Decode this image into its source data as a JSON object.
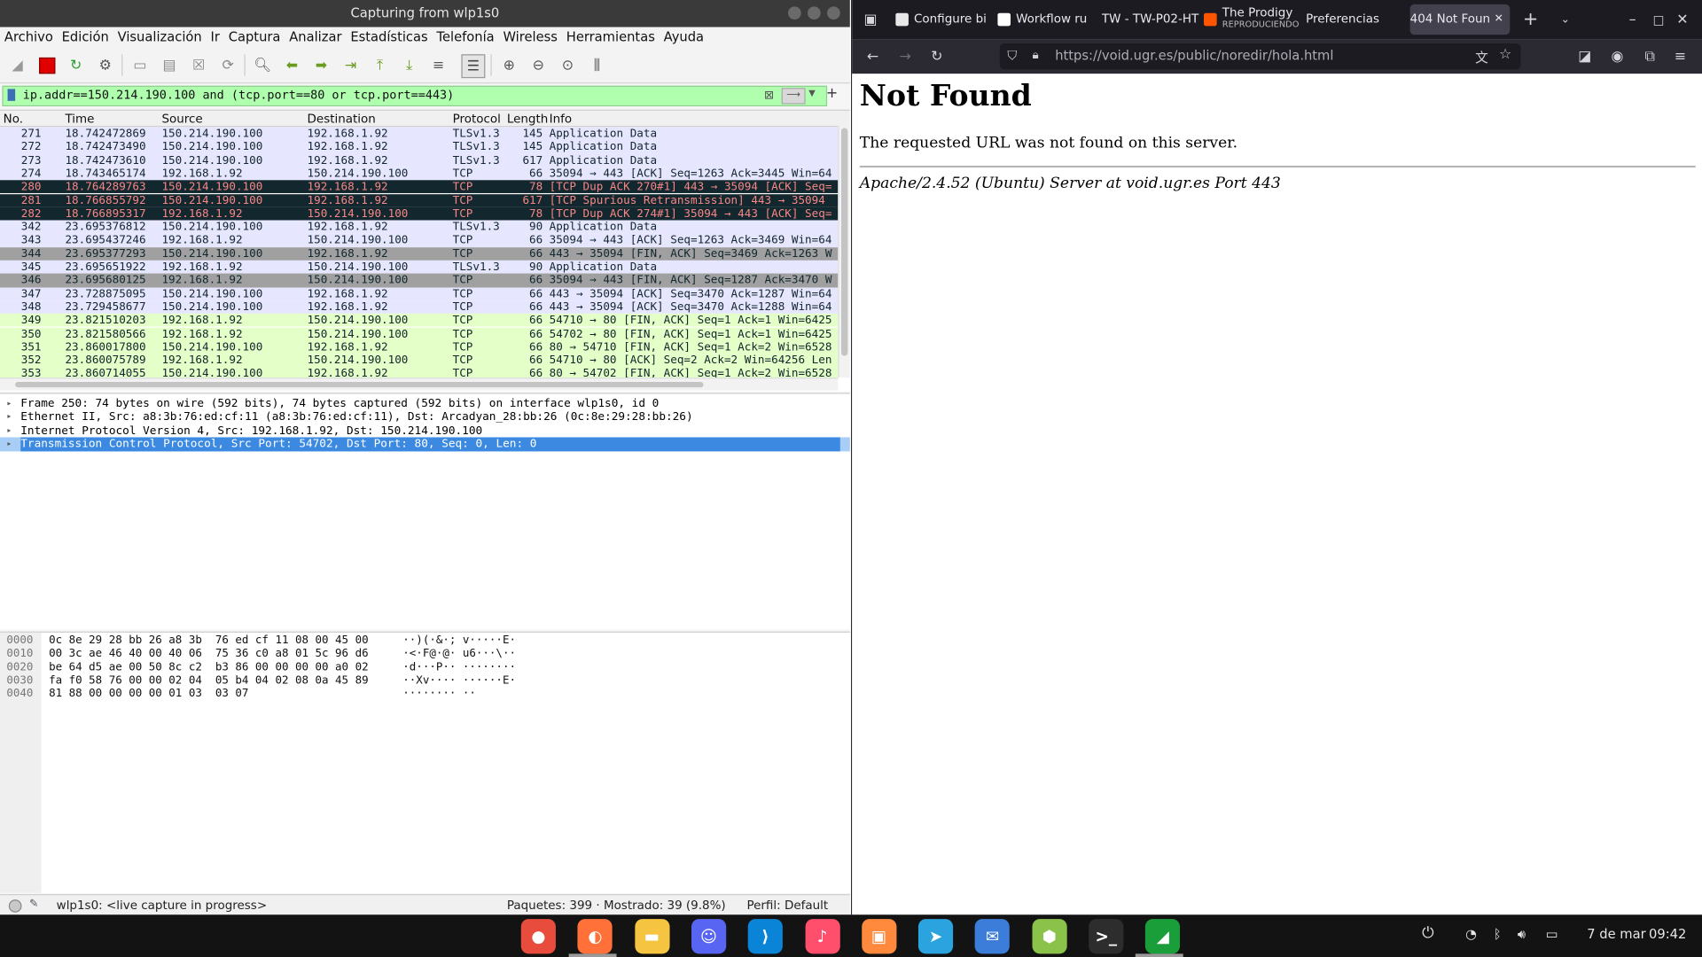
{
  "wireshark": {
    "title": "Capturing from wlp1s0",
    "menu": [
      "Archivo",
      "Edición",
      "Visualización",
      "Ir",
      "Captura",
      "Analizar",
      "Estadísticas",
      "Telefonía",
      "Wireless",
      "Herramientas",
      "Ayuda"
    ],
    "filter": "ip.addr==150.214.190.100 and (tcp.port==80 or tcp.port==443)",
    "columns": [
      "No.",
      "Time",
      "Source",
      "Destination",
      "Protocol",
      "Length",
      "Info"
    ],
    "packets": [
      {
        "no": "271",
        "time": "18.742472869",
        "src": "150.214.190.100",
        "dst": "192.168.1.92",
        "proto": "TLSv1.3",
        "len": "145",
        "info": "Application Data",
        "bg": "#e7e6ff",
        "fg": "#12272e"
      },
      {
        "no": "272",
        "time": "18.742473490",
        "src": "150.214.190.100",
        "dst": "192.168.1.92",
        "proto": "TLSv1.3",
        "len": "145",
        "info": "Application Data",
        "bg": "#e7e6ff",
        "fg": "#12272e"
      },
      {
        "no": "273",
        "time": "18.742473610",
        "src": "150.214.190.100",
        "dst": "192.168.1.92",
        "proto": "TLSv1.3",
        "len": "617",
        "info": "Application Data",
        "bg": "#e7e6ff",
        "fg": "#12272e"
      },
      {
        "no": "274",
        "time": "18.743465174",
        "src": "192.168.1.92",
        "dst": "150.214.190.100",
        "proto": "TCP",
        "len": "66",
        "info": "35094 → 443 [ACK] Seq=1263 Ack=3445 Win=64",
        "bg": "#e7e6ff",
        "fg": "#12272e"
      },
      {
        "no": "280",
        "time": "18.764289763",
        "src": "150.214.190.100",
        "dst": "192.168.1.92",
        "proto": "TCP",
        "len": "78",
        "info": "[TCP Dup ACK 270#1] 443 → 35094 [ACK] Seq=",
        "bg": "#12272e",
        "fg": "#f78787"
      },
      {
        "no": "281",
        "time": "18.766855792",
        "src": "150.214.190.100",
        "dst": "192.168.1.92",
        "proto": "TCP",
        "len": "617",
        "info": "[TCP Spurious Retransmission] 443 → 35094",
        "bg": "#12272e",
        "fg": "#f78787"
      },
      {
        "no": "282",
        "time": "18.766895317",
        "src": "192.168.1.92",
        "dst": "150.214.190.100",
        "proto": "TCP",
        "len": "78",
        "info": "[TCP Dup ACK 274#1] 35094 → 443 [ACK] Seq=",
        "bg": "#12272e",
        "fg": "#f78787"
      },
      {
        "no": "342",
        "time": "23.695376812",
        "src": "150.214.190.100",
        "dst": "192.168.1.92",
        "proto": "TLSv1.3",
        "len": "90",
        "info": "Application Data",
        "bg": "#e7e6ff",
        "fg": "#12272e"
      },
      {
        "no": "343",
        "time": "23.695437246",
        "src": "192.168.1.92",
        "dst": "150.214.190.100",
        "proto": "TCP",
        "len": "66",
        "info": "35094 → 443 [ACK] Seq=1263 Ack=3469 Win=64",
        "bg": "#e7e6ff",
        "fg": "#12272e"
      },
      {
        "no": "344",
        "time": "23.695377293",
        "src": "150.214.190.100",
        "dst": "192.168.1.92",
        "proto": "TCP",
        "len": "66",
        "info": "443 → 35094 [FIN, ACK] Seq=3469 Ack=1263 W",
        "bg": "#a0a0a0",
        "fg": "#12272e"
      },
      {
        "no": "345",
        "time": "23.695651922",
        "src": "192.168.1.92",
        "dst": "150.214.190.100",
        "proto": "TLSv1.3",
        "len": "90",
        "info": "Application Data",
        "bg": "#e7e6ff",
        "fg": "#12272e"
      },
      {
        "no": "346",
        "time": "23.695680125",
        "src": "192.168.1.92",
        "dst": "150.214.190.100",
        "proto": "TCP",
        "len": "66",
        "info": "35094 → 443 [FIN, ACK] Seq=1287 Ack=3470 W",
        "bg": "#a0a0a0",
        "fg": "#12272e"
      },
      {
        "no": "347",
        "time": "23.728875095",
        "src": "150.214.190.100",
        "dst": "192.168.1.92",
        "proto": "TCP",
        "len": "66",
        "info": "443 → 35094 [ACK] Seq=3470 Ack=1287 Win=64",
        "bg": "#e7e6ff",
        "fg": "#12272e"
      },
      {
        "no": "348",
        "time": "23.729458677",
        "src": "150.214.190.100",
        "dst": "192.168.1.92",
        "proto": "TCP",
        "len": "66",
        "info": "443 → 35094 [ACK] Seq=3470 Ack=1288 Win=64",
        "bg": "#e7e6ff",
        "fg": "#12272e"
      },
      {
        "no": "349",
        "time": "23.821510203",
        "src": "192.168.1.92",
        "dst": "150.214.190.100",
        "proto": "TCP",
        "len": "66",
        "info": "54710 → 80 [FIN, ACK] Seq=1 Ack=1 Win=6425",
        "bg": "#e4ffc7",
        "fg": "#12272e"
      },
      {
        "no": "350",
        "time": "23.821580566",
        "src": "192.168.1.92",
        "dst": "150.214.190.100",
        "proto": "TCP",
        "len": "66",
        "info": "54702 → 80 [FIN, ACK] Seq=1 Ack=1 Win=6425",
        "bg": "#e4ffc7",
        "fg": "#12272e"
      },
      {
        "no": "351",
        "time": "23.860017800",
        "src": "150.214.190.100",
        "dst": "192.168.1.92",
        "proto": "TCP",
        "len": "66",
        "info": "80 → 54710 [FIN, ACK] Seq=1 Ack=2 Win=6528",
        "bg": "#e4ffc7",
        "fg": "#12272e"
      },
      {
        "no": "352",
        "time": "23.860075789",
        "src": "192.168.1.92",
        "dst": "150.214.190.100",
        "proto": "TCP",
        "len": "66",
        "info": "54710 → 80 [ACK] Seq=2 Ack=2 Win=64256 Len",
        "bg": "#e4ffc7",
        "fg": "#12272e"
      },
      {
        "no": "353",
        "time": "23.860714055",
        "src": "150.214.190.100",
        "dst": "192.168.1.92",
        "proto": "TCP",
        "len": "66",
        "info": "80 → 54702 [FIN, ACK] Seq=1 Ack=2 Win=6528",
        "bg": "#e4ffc7",
        "fg": "#12272e"
      }
    ],
    "details": [
      {
        "text": "Frame 250: 74 bytes on wire (592 bits), 74 bytes captured (592 bits) on interface wlp1s0, id 0",
        "selected": false
      },
      {
        "text": "Ethernet II, Src: a8:3b:76:ed:cf:11 (a8:3b:76:ed:cf:11), Dst: Arcadyan_28:bb:26 (0c:8e:29:28:bb:26)",
        "selected": false
      },
      {
        "text": "Internet Protocol Version 4, Src: 192.168.1.92, Dst: 150.214.190.100",
        "selected": false
      },
      {
        "text": "Transmission Control Protocol, Src Port: 54702, Dst Port: 80, Seq: 0, Len: 0",
        "selected": true
      }
    ],
    "hex": [
      {
        "off": "0000",
        "bytes": "0c 8e 29 28 bb 26 a8 3b  76 ed cf 11 08 00 45 00",
        "ascii": "··)(·&·; v·····E·"
      },
      {
        "off": "0010",
        "bytes": "00 3c ae 46 40 00 40 06  75 36 c0 a8 01 5c 96 d6",
        "ascii": "·<·F@·@· u6···\\··"
      },
      {
        "off": "0020",
        "bytes": "be 64 d5 ae 00 50 8c c2  b3 86 00 00 00 00 a0 02",
        "ascii": "·d···P·· ········"
      },
      {
        "off": "0030",
        "bytes": "fa f0 58 76 00 00 02 04  05 b4 04 02 08 0a 45 89",
        "ascii": "··Xv···· ······E·"
      },
      {
        "off": "0040",
        "bytes": "81 88 00 00 00 00 01 03  03 07",
        "ascii": "········ ··"
      }
    ],
    "status": {
      "interface": "wlp1s0: <live capture in progress>",
      "packets": "Paquetes: 399 · Mostrado: 39 (9.8%)",
      "profile": "Perfil: Default"
    }
  },
  "firefox": {
    "tabs": [
      {
        "label": "Configure bi",
        "icon_color": "#e8e8e8",
        "active": false
      },
      {
        "label": "Workflow ru",
        "icon_color": "#ffffff",
        "active": false
      },
      {
        "label": "TW - TW-P02-HT",
        "icon_color": "",
        "active": false
      },
      {
        "label": "The Prodigy",
        "sub": "REPRODUCIENDO",
        "icon_color": "#ff5500",
        "active": false
      },
      {
        "label": "Preferencias",
        "icon_color": "",
        "active": false
      },
      {
        "label": "404 Not Foun",
        "icon_color": "",
        "active": true
      }
    ],
    "url": "https://void.ugr.es/public/noredir/hola.html",
    "page": {
      "heading": "Not Found",
      "message": "The requested URL was not found on this server.",
      "address": "Apache/2.4.52 (Ubuntu) Server at void.ugr.es Port 443"
    }
  },
  "taskbar": {
    "apps": [
      {
        "name": "recorder-icon",
        "color": "#e84c3d"
      },
      {
        "name": "firefox-icon",
        "color": "#ff7139"
      },
      {
        "name": "files-icon",
        "color": "#f5c542"
      },
      {
        "name": "discord-icon",
        "color": "#5865f2"
      },
      {
        "name": "vscode-icon",
        "color": "#0a84d6"
      },
      {
        "name": "music-icon",
        "color": "#ff4f6d"
      },
      {
        "name": "store-icon",
        "color": "#ff8a3d"
      },
      {
        "name": "telegram-icon",
        "color": "#2aa3df"
      },
      {
        "name": "mail-icon",
        "color": "#3b7dd8"
      },
      {
        "name": "box-icon",
        "color": "#8bc34a"
      },
      {
        "name": "terminal-icon",
        "color": "#2d2d2d"
      },
      {
        "name": "wireshark-icon",
        "color": "#1a9e3a"
      }
    ],
    "date": "7 de mar",
    "time": "09:42"
  }
}
